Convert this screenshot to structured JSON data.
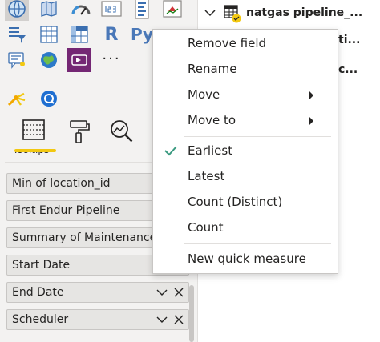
{
  "visualizations": {
    "icons": [
      {
        "name": "map-icon"
      },
      {
        "name": "filled-map-icon"
      },
      {
        "name": "gauge-icon"
      },
      {
        "name": "card-icon"
      },
      {
        "name": "multi-row-card-icon"
      },
      {
        "name": "kpi-icon"
      },
      {
        "name": "slicer-icon"
      },
      {
        "name": "table-icon"
      },
      {
        "name": "matrix-icon"
      },
      {
        "name": "r-visual-icon"
      },
      {
        "name": "python-visual-icon"
      },
      {
        "name": "smart-narrative-icon"
      },
      {
        "name": "arcgis-map-icon"
      },
      {
        "name": "power-apps-icon"
      },
      {
        "name": "more-visuals-icon"
      },
      {
        "name": "key-influencers-icon"
      },
      {
        "name": "qna-icon"
      }
    ],
    "r_letter": "R",
    "py_letters": "Py",
    "more_text": "···",
    "tabs": [
      {
        "name": "fields-tab"
      },
      {
        "name": "format-tab"
      },
      {
        "name": "analytics-tab"
      }
    ],
    "active_tab_label": "Tooltips"
  },
  "wells": [
    {
      "label": "Min of location_id",
      "controls": false
    },
    {
      "label": "First Endur Pipeline",
      "controls": false
    },
    {
      "label": "Summary of Maintenance",
      "controls": false
    },
    {
      "label": "Start Date",
      "controls": false
    },
    {
      "label": "End Date",
      "controls": true
    },
    {
      "label": "Scheduler",
      "controls": true
    }
  ],
  "fields": {
    "table_name": "natgas pipeline_...",
    "peek_1": "ti...",
    "peek_2": "c..."
  },
  "context_menu": {
    "items": [
      {
        "label": "Remove field",
        "submenu": false,
        "checked": false
      },
      {
        "label": "Rename",
        "submenu": false,
        "checked": false
      },
      {
        "label": "Move",
        "submenu": true,
        "checked": false
      },
      {
        "label": "Move to",
        "submenu": true,
        "checked": false
      },
      {
        "label": "Earliest",
        "submenu": false,
        "checked": true
      },
      {
        "label": "Latest",
        "submenu": false,
        "checked": false
      },
      {
        "label": "Count (Distinct)",
        "submenu": false,
        "checked": false
      },
      {
        "label": "Count",
        "submenu": false,
        "checked": false
      },
      {
        "label": "New quick measure",
        "submenu": false,
        "checked": false
      }
    ]
  },
  "colors": {
    "accent_yellow": "#f2c811",
    "check_green": "#3a9a80",
    "powerbi_blue": "#4a78b8",
    "pane_bg": "#f3f2f1"
  }
}
